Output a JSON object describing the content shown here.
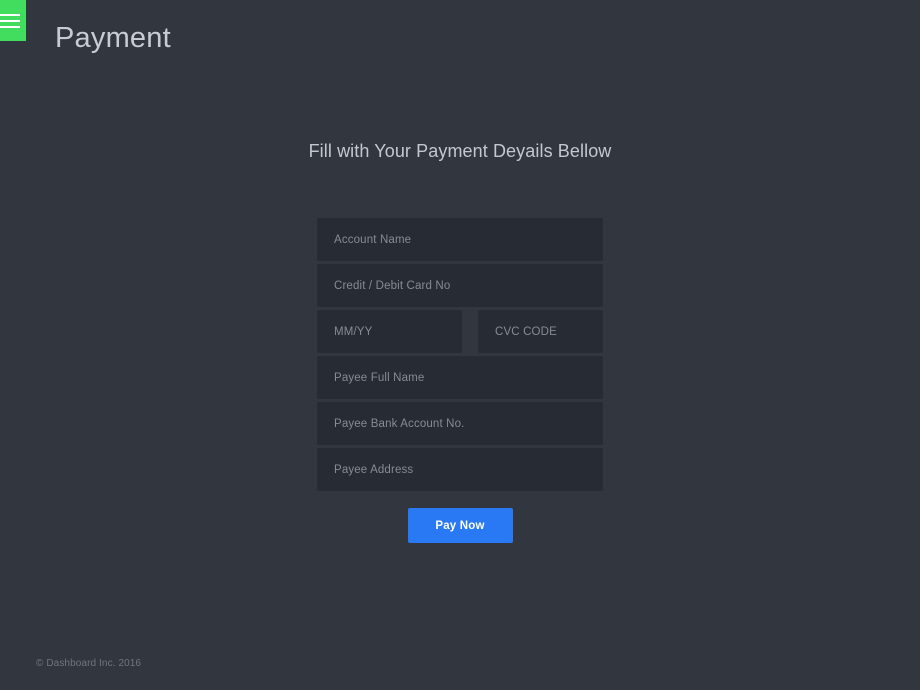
{
  "theme": {
    "page_bg": "#32363f",
    "field_bg": "#272b33",
    "accent_green": "#42dd5e",
    "accent_blue": "#2979f5",
    "title_color": "#c8ccd2",
    "placeholder_color": "#868b94",
    "footer_color": "#70757e"
  },
  "header": {
    "menu_icon": "hamburger-menu-icon",
    "title": "Payment"
  },
  "main": {
    "heading": "Fill with Your Payment Deyails Bellow",
    "fields": [
      {
        "name": "account-name",
        "placeholder": "Account Name",
        "value": ""
      },
      {
        "name": "credit-debit-card-no",
        "placeholder": "Credit / Debit Card No",
        "value": ""
      },
      {
        "name": "expiry-date",
        "placeholder": "MM/YY",
        "value": ""
      },
      {
        "name": "cvc-code",
        "placeholder": "CVC CODE",
        "value": ""
      },
      {
        "name": "payee-full-name",
        "placeholder": "Payee Full Name",
        "value": ""
      },
      {
        "name": "payee-bank-account-no",
        "placeholder": "Payee Bank Account No.",
        "value": ""
      },
      {
        "name": "payee-address",
        "placeholder": "Payee Address",
        "value": ""
      }
    ],
    "submit_label": "Pay Now"
  },
  "footer": {
    "copyright": "© Dashboard Inc. 2016"
  }
}
